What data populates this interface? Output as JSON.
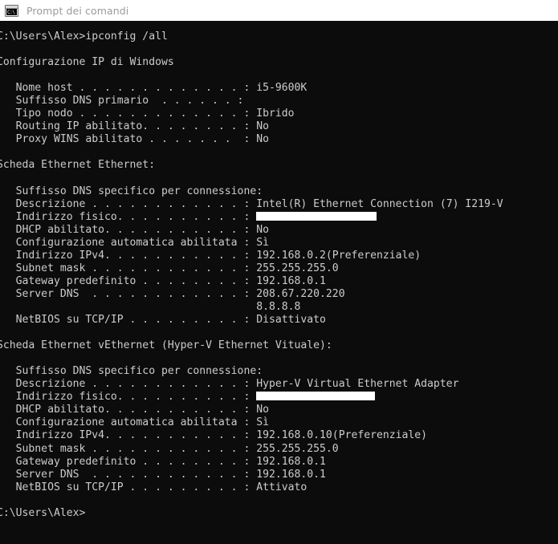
{
  "window": {
    "title": "Prompt dei comandi",
    "icon": "command-prompt-icon",
    "icon_glyph": "C:\\",
    "titlebar_bg": "#ffffff",
    "titlebar_text_color": "#9a9a9a",
    "console_bg": "#0c0c0c",
    "console_fg": "#cccccc",
    "redaction_color": "#ffffff"
  },
  "console": {
    "prompt_command_line": "C:\\Users\\Alex>ipconfig /all",
    "prompt_path": "C:\\Users\\Alex>",
    "command": "ipconfig /all",
    "final_prompt": "C:\\Users\\Alex>",
    "windows_ip_config_header": "Configurazione IP di Windows",
    "global": [
      {
        "label": "Nome host",
        "dots": ". . . . . . . . . . . . . .",
        "value": "i5-9600K"
      },
      {
        "label": "Suffisso DNS primario",
        "dots": ". . . . . . . .",
        "value": ""
      },
      {
        "label": "Tipo nodo",
        "dots": ". . . . . . . . . . . . . .",
        "value": "Ibrido"
      },
      {
        "label": "Routing IP abilitato.",
        "dots": ". . . . . . . . .",
        "value": "No"
      },
      {
        "label": "Proxy WINS abilitato",
        "dots": ". . . . . . . . .",
        "value": "No"
      }
    ],
    "adapters": [
      {
        "header": "Scheda Ethernet Ethernet:",
        "rows": [
          {
            "label": "Suffisso DNS specifico per connessione:",
            "dots": "",
            "value": ""
          },
          {
            "label": "Descrizione",
            "dots": ". . . . . . . . . . . . .",
            "value": "Intel(R) Ethernet Connection (7) I219-V"
          },
          {
            "label": "Indirizzo fisico.",
            "dots": ". . . . . . . . . .",
            "value": "[REDACTED]",
            "redacted": true
          },
          {
            "label": "DHCP abilitato.",
            "dots": ". . . . . . . . . . .",
            "value": "No"
          },
          {
            "label": "Configurazione automatica abilitata",
            "dots": "",
            "value": "Sì"
          },
          {
            "label": "Indirizzo IPv4.",
            "dots": ". . . . . . . . . . . .",
            "value": "192.168.0.2(Preferenziale)"
          },
          {
            "label": "Subnet mask",
            "dots": ". . . . . . . . . . . . .",
            "value": "255.255.255.0"
          },
          {
            "label": "Gateway predefinito",
            "dots": ". . . . . . . . . .",
            "value": "192.168.0.1"
          },
          {
            "label": "Server DNS",
            "dots": ". . . . . . . . . . . . . .",
            "value": "208.67.220.220"
          },
          {
            "label": "",
            "dots": "",
            "value": "8.8.8.8",
            "continuation": true
          },
          {
            "label": "NetBIOS su TCP/IP",
            "dots": ". . . . . . . . . .",
            "value": "Disattivato"
          }
        ]
      },
      {
        "header": "Scheda Ethernet vEthernet (Hyper-V Ethernet Vituale):",
        "rows": [
          {
            "label": "Suffisso DNS specifico per connessione:",
            "dots": "",
            "value": ""
          },
          {
            "label": "Descrizione",
            "dots": ". . . . . . . . . . . . .",
            "value": "Hyper-V Virtual Ethernet Adapter"
          },
          {
            "label": "Indirizzo fisico.",
            "dots": ". . . . . . . . . .",
            "value": "[REDACTED]",
            "redacted": true
          },
          {
            "label": "DHCP abilitato.",
            "dots": ". . . . . . . . . . .",
            "value": "No"
          },
          {
            "label": "Configurazione automatica abilitata",
            "dots": "",
            "value": "Sì"
          },
          {
            "label": "Indirizzo IPv4.",
            "dots": ". . . . . . . . . . . .",
            "value": "192.168.0.10(Preferenziale)"
          },
          {
            "label": "Subnet mask",
            "dots": ". . . . . . . . . . . . .",
            "value": "255.255.255.0"
          },
          {
            "label": "Gateway predefinito",
            "dots": ". . . . . . . . . .",
            "value": "192.168.0.1"
          },
          {
            "label": "Server DNS",
            "dots": ". . . . . . . . . . . . . .",
            "value": "192.168.0.1"
          },
          {
            "label": "NetBIOS su TCP/IP",
            "dots": ". . . . . . . . . .",
            "value": "Attivato"
          }
        ]
      }
    ],
    "raw_lines": [
      "C:\\Users\\Alex>ipconfig /all",
      "",
      "Configurazione IP di Windows",
      "",
      "   Nome host . . . . . . . . . . . . . : i5-9600K",
      "   Suffisso DNS primario  . . . . . . :",
      "   Tipo nodo . . . . . . . . . . . . . : Ibrido",
      "   Routing IP abilitato. . . . . . . . : No",
      "   Proxy WINS abilitato . . . . . . .  : No",
      "",
      "Scheda Ethernet Ethernet:",
      "",
      "   Suffisso DNS specifico per connessione:",
      "   Descrizione . . . . . . . . . . . . : Intel(R) Ethernet Connection (7) I219-V",
      "   Indirizzo fisico. . . . . . . . . . : @@REDACT1@@",
      "   DHCP abilitato. . . . . . . . . . . : No",
      "   Configurazione automatica abilitata : Sì",
      "   Indirizzo IPv4. . . . . . . . . . . : 192.168.0.2(Preferenziale)",
      "   Subnet mask . . . . . . . . . . . . : 255.255.255.0",
      "   Gateway predefinito . . . . . . . . : 192.168.0.1",
      "   Server DNS  . . . . . . . . . . . . : 208.67.220.220",
      "                                         8.8.8.8",
      "   NetBIOS su TCP/IP . . . . . . . . . : Disattivato",
      "",
      "Scheda Ethernet vEthernet (Hyper-V Ethernet Vituale):",
      "",
      "   Suffisso DNS specifico per connessione:",
      "   Descrizione . . . . . . . . . . . . : Hyper-V Virtual Ethernet Adapter",
      "   Indirizzo fisico. . . . . . . . . . : @@REDACT2@@",
      "   DHCP abilitato. . . . . . . . . . . : No",
      "   Configurazione automatica abilitata : Sì",
      "   Indirizzo IPv4. . . . . . . . . . . : 192.168.0.10(Preferenziale)",
      "   Subnet mask . . . . . . . . . . . . : 255.255.255.0",
      "   Gateway predefinito . . . . . . . . : 192.168.0.1",
      "   Server DNS  . . . . . . . . . . . . : 192.168.0.1",
      "   NetBIOS su TCP/IP . . . . . . . . . : Attivato",
      "",
      "C:\\Users\\Alex>"
    ]
  }
}
